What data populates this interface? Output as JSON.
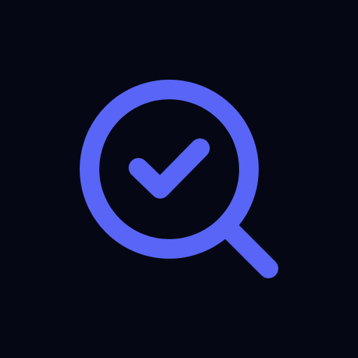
{
  "icon": {
    "name": "search-check-icon",
    "background_color": "#050814",
    "accent_color": "#5865F6"
  }
}
